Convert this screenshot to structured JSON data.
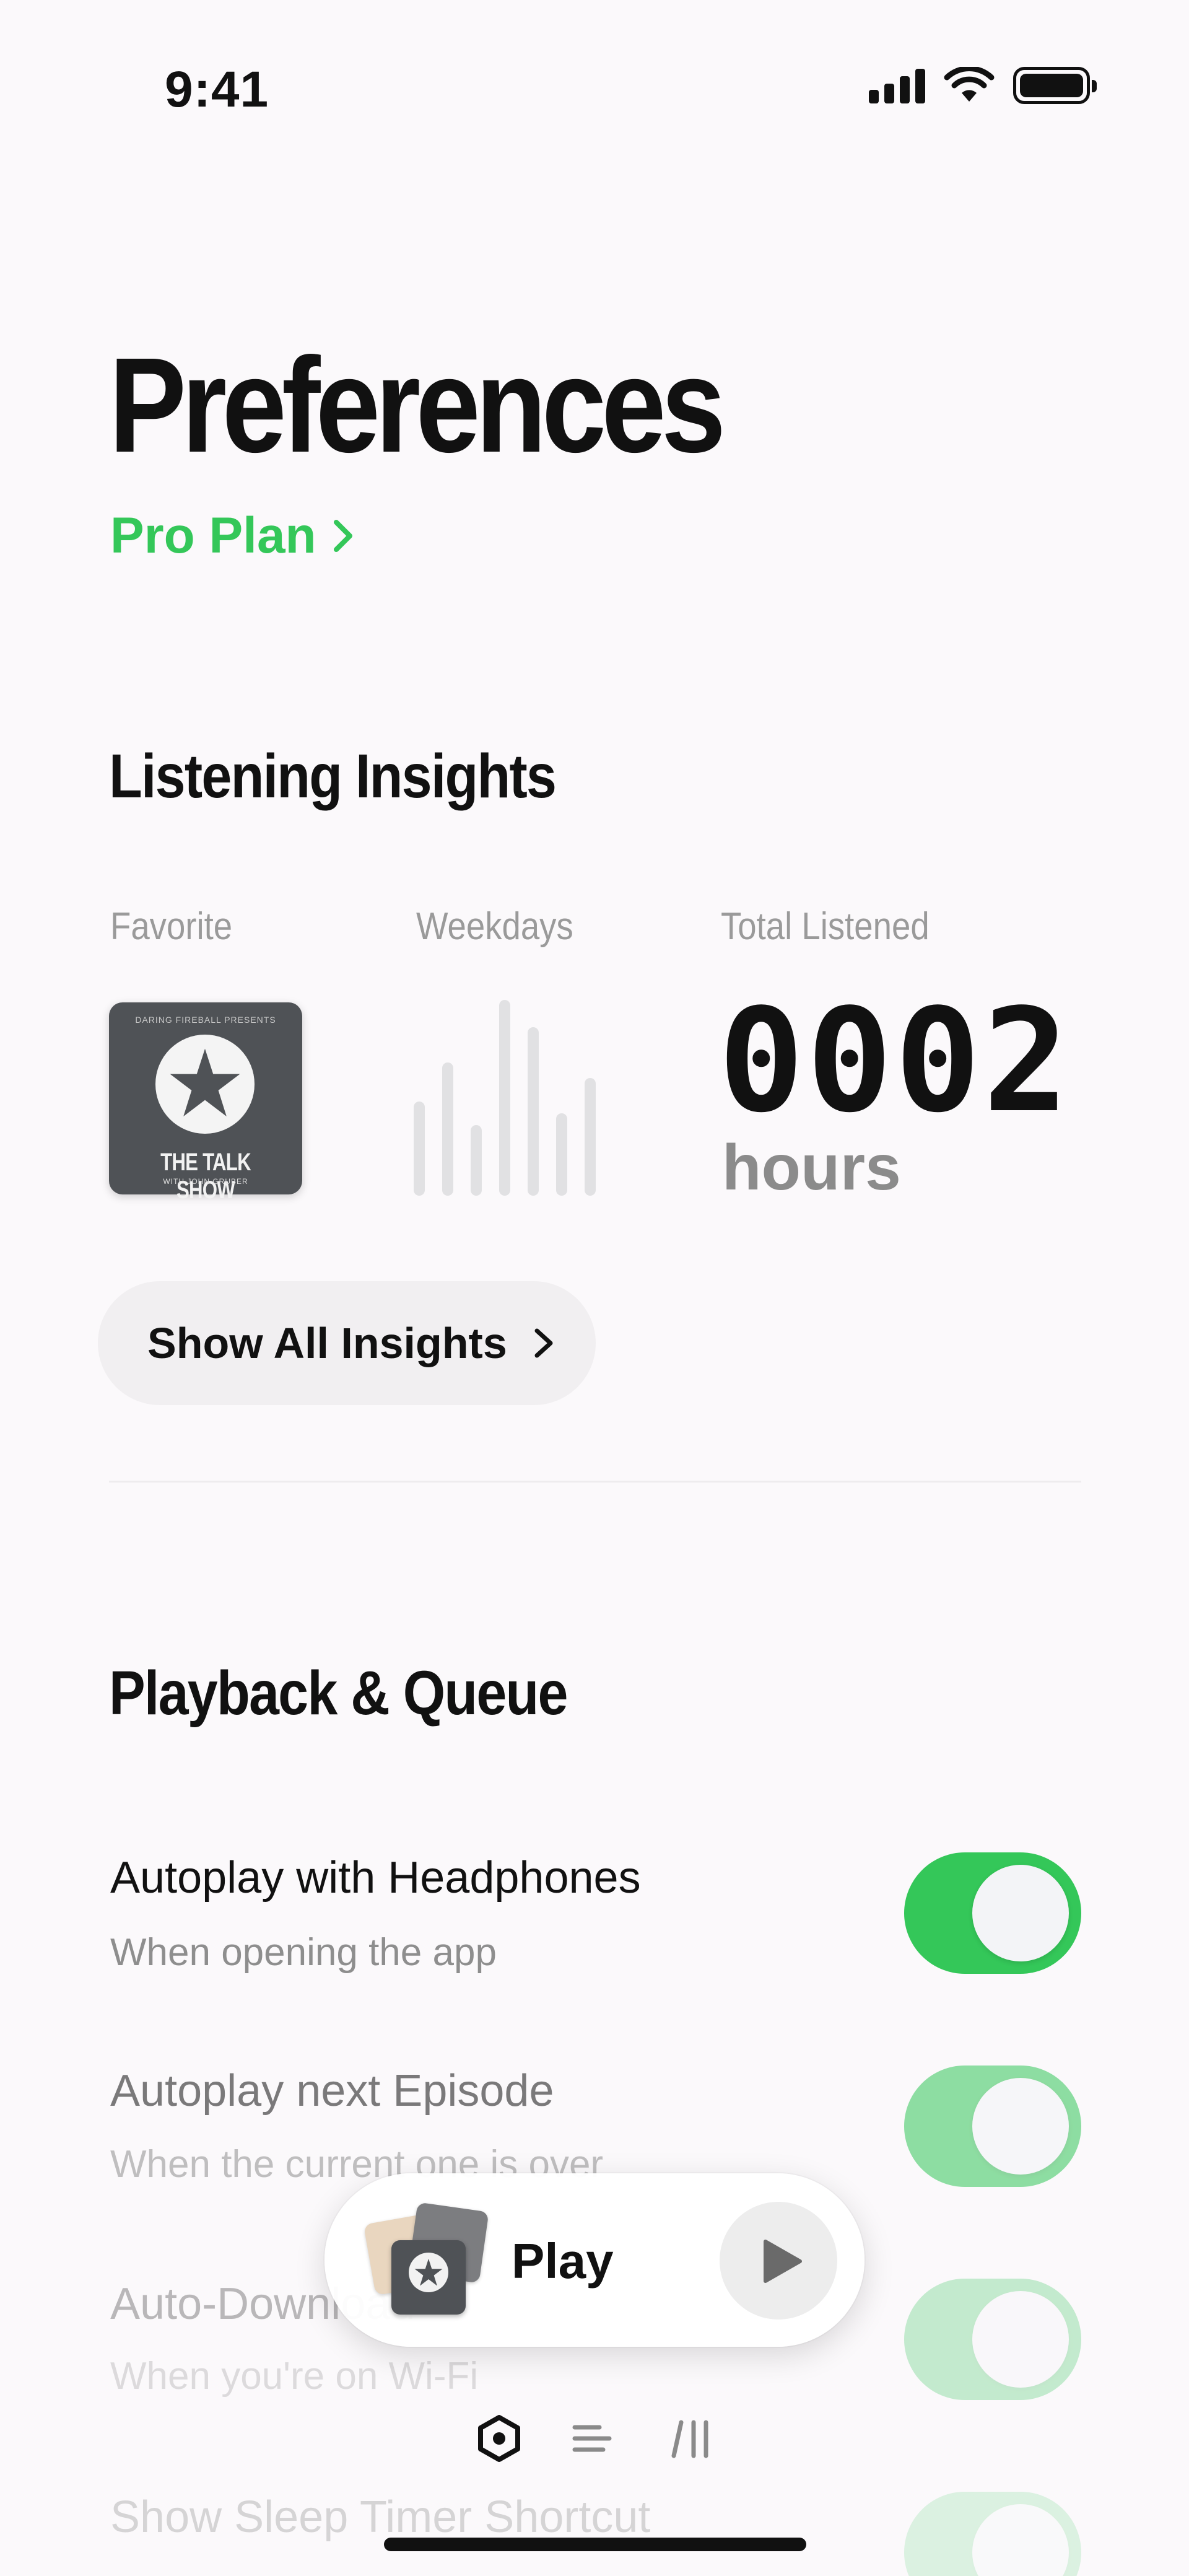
{
  "status_bar": {
    "time": "9:41",
    "icons": [
      "cellular-signal-icon",
      "wifi-icon",
      "battery-icon"
    ]
  },
  "header": {
    "title": "Preferences",
    "plan_link": "Pro Plan"
  },
  "insights": {
    "title": "Listening Insights",
    "favorite_label": "Favorite",
    "weekdays_label": "Weekdays",
    "total_label": "Total Listened",
    "favorite_show": {
      "name": "THE TALK SHOW",
      "host": "WITH JOHN GRUBER",
      "tagline": "DARING FIREBALL PRESENTS"
    },
    "weekday_levels": [
      0.48,
      0.68,
      0.36,
      1.0,
      0.86,
      0.42,
      0.6
    ],
    "total_value": "0002",
    "total_unit": "hours",
    "button_label": "Show All Insights"
  },
  "playback": {
    "title": "Playback & Queue",
    "rows": [
      {
        "title": "Autoplay with Headphones",
        "subtitle": "When opening the app",
        "enabled": true
      },
      {
        "title": "Autoplay next Episode",
        "subtitle": "When the current one is over",
        "enabled": true
      },
      {
        "title": "Auto-Download",
        "subtitle": "When you're on Wi-Fi",
        "enabled": true
      },
      {
        "title": "Show Sleep Timer Shortcut",
        "subtitle": "",
        "enabled": true
      }
    ]
  },
  "mini_player": {
    "label": "Play",
    "play_icon": "play-icon"
  },
  "tab_bar": {
    "tabs": [
      "settings-hexagon-icon",
      "queue-list-icon",
      "library-icon"
    ]
  },
  "colors": {
    "accent": "#34c759",
    "background": "#fbf9fb",
    "muted_text": "#8e8e8e"
  }
}
